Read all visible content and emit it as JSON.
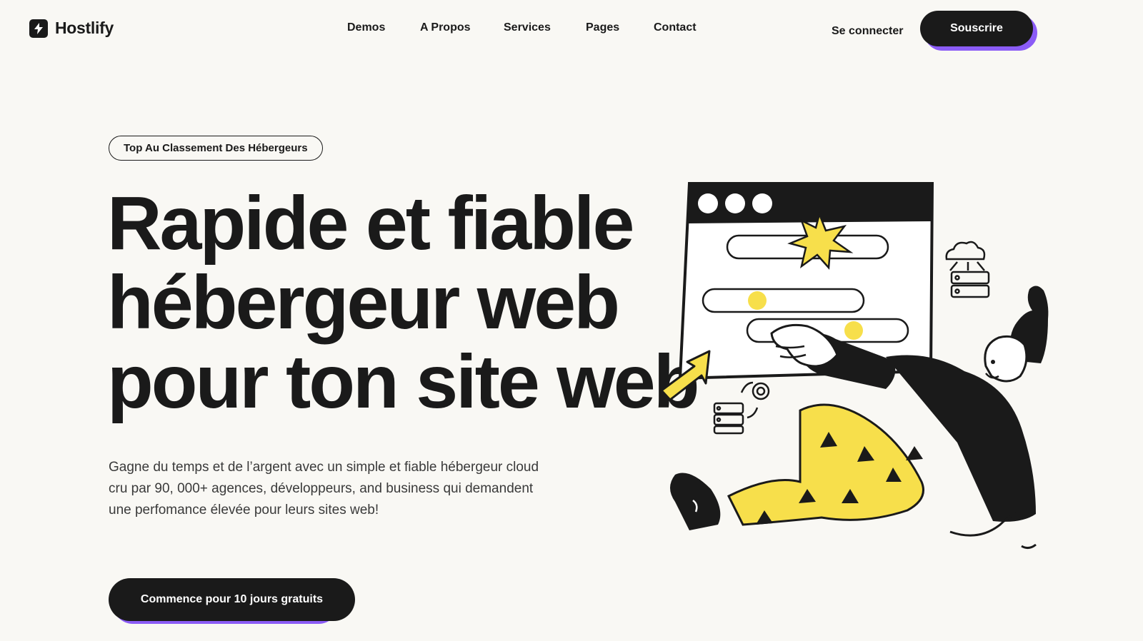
{
  "brand": {
    "name": "Hostlify",
    "logo_icon": "bolt-icon"
  },
  "nav": {
    "items": [
      {
        "label": "Demos"
      },
      {
        "label": "A Propos"
      },
      {
        "label": "Services"
      },
      {
        "label": "Pages"
      },
      {
        "label": "Contact"
      }
    ],
    "login_label": "Se connecter",
    "subscribe_label": "Souscrire"
  },
  "hero": {
    "badge": "Top Au Classement Des Hébergeurs",
    "headline_lines": [
      "Rapide et fiable",
      "hébergeur web",
      "pour ton site web"
    ],
    "description": "Gagne du temps et de l’argent avec un simple et fiable hébergeur cloud cru par 90, 000+ agences, développeurs, and business qui demandent une perfomance élevée pour leurs sites web!",
    "cta_label": "Commence pour 10 jours gratuits"
  },
  "colors": {
    "background": "#f9f8f4",
    "ink": "#1a1a1a",
    "accent_purple": "#8b5cf6",
    "accent_yellow": "#f7df4b"
  }
}
